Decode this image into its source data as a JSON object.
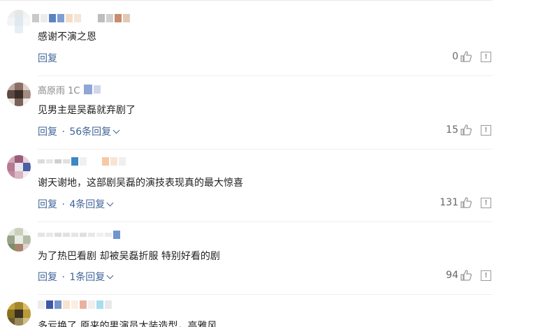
{
  "comments": [
    {
      "username": "",
      "text": "感谢不演之恩",
      "reply_label": "回复",
      "sub_replies": "",
      "likes": "0"
    },
    {
      "username": "高原雨 1C",
      "text": "见男主是吴磊就弃剧了",
      "reply_label": "回复",
      "sub_replies": "56条回复",
      "likes": "15"
    },
    {
      "username": "",
      "text": "谢天谢地，这部剧吴磊的演技表现真的最大惊喜",
      "reply_label": "回复",
      "sub_replies": "4条回复",
      "likes": "131"
    },
    {
      "username": "",
      "text": "为了热巴看剧 却被吴磊折服 特别好看的剧",
      "reply_label": "回复",
      "sub_replies": "1条回复",
      "likes": "94"
    },
    {
      "username": "",
      "text": "多亏换了 原来的男演员太装造型，高雅风",
      "reply_label": "",
      "sub_replies": "",
      "likes": ""
    }
  ],
  "separator": "·",
  "icons": {
    "like": "thumbs-up-icon",
    "report": "report-icon",
    "expand": "chevron-down-icon"
  },
  "colors": {
    "link": "#406599",
    "text": "#222222",
    "muted": "#666666"
  }
}
